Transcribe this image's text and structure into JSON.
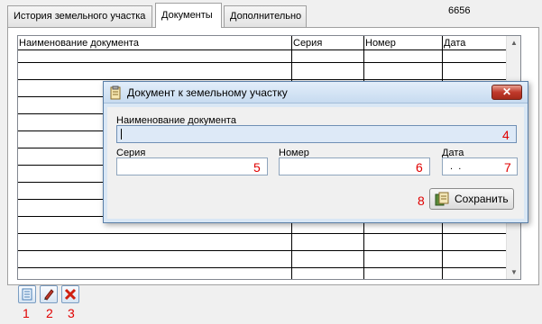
{
  "tabs": [
    {
      "label": "История земельного участка",
      "active": false
    },
    {
      "label": "Документы",
      "active": true
    },
    {
      "label": "Дополнительно",
      "active": false
    }
  ],
  "record_id": "6656",
  "table": {
    "columns": [
      "Наименование документа",
      "Серия",
      "Номер",
      "Дата"
    ],
    "rows": []
  },
  "toolbar": {
    "add_icon": "document-add-icon",
    "edit_icon": "pencil-icon",
    "delete_icon": "delete-x-icon"
  },
  "annotations": {
    "add": "1",
    "edit": "2",
    "delete": "3",
    "name": "4",
    "series": "5",
    "number": "6",
    "date": "7",
    "save": "8"
  },
  "dialog": {
    "title": "Документ к земельному участку",
    "close_label": "✕",
    "name_label": "Наименование документа",
    "name_value": "",
    "series_label": "Серия",
    "series_value": "",
    "number_label": "Номер",
    "number_value": "",
    "date_label": "Дата",
    "date_value": " .  . ",
    "save_label": "Сохранить"
  },
  "colors": {
    "annotation": "#e00000",
    "dialog_bg": "#d9e7f5",
    "focus_field": "#dde9f7"
  }
}
